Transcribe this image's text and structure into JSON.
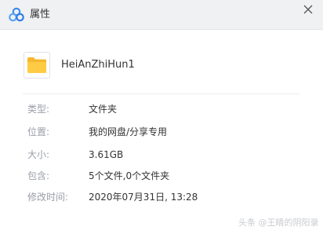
{
  "titlebar": {
    "title": "属性",
    "logo_icon": "cloud-logo-icon",
    "close_icon": "close-icon",
    "background": "#f0f1f3"
  },
  "file": {
    "icon": "folder-icon",
    "icon_color": "#ffc83d",
    "name": "HeiAnZhiHun1"
  },
  "properties": [
    {
      "label": "类型:",
      "value": "文件夹"
    },
    {
      "label": "位置:",
      "value": "我的网盘/分享专用"
    },
    {
      "label": "大小:",
      "value": "3.61GB"
    },
    {
      "label": "包含:",
      "value": "5个文件,0个文件夹"
    },
    {
      "label": "修改时间:",
      "value": "2020年07月31日, 13:28"
    }
  ],
  "watermark": "头条 @王睛的阴阳录"
}
